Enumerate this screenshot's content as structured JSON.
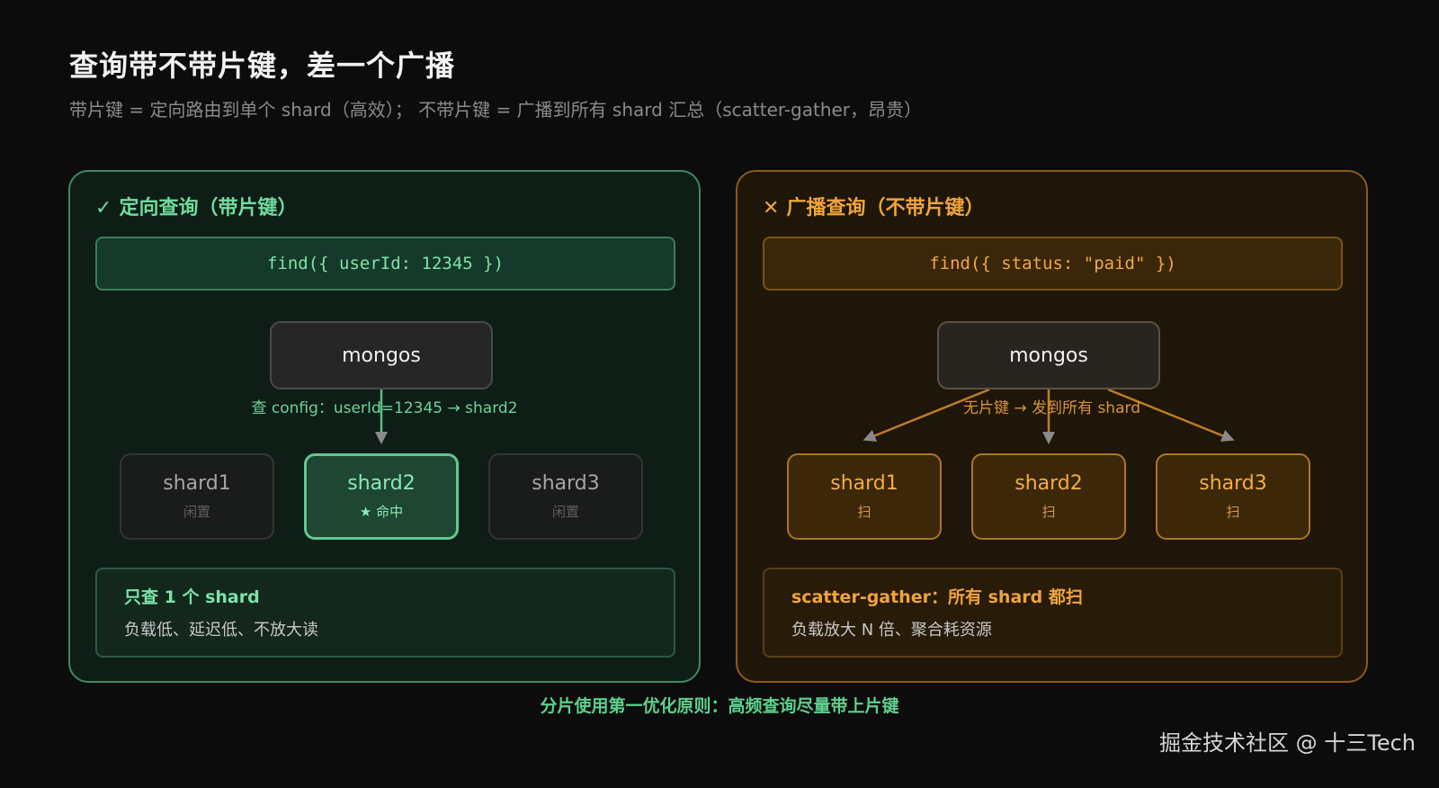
{
  "header": {
    "title": "查询带不带片键，差一个广播",
    "subtitle": "带片键 = 定向路由到单个 shard（高效）； 不带片键 = 广播到所有 shard 汇总（scatter-gather，昂贵）"
  },
  "targeted": {
    "mark": "✓",
    "heading": "定向查询（带片键）",
    "query": "find({ userId: 12345 })",
    "router": "mongos",
    "edge_label": "查 config：userId=12345 → shard2",
    "shards": [
      {
        "name": "shard1",
        "status": "闲置"
      },
      {
        "name": "shard2",
        "status": "★ 命中"
      },
      {
        "name": "shard3",
        "status": "闲置"
      }
    ],
    "summary_title": "只查 1 个 shard",
    "summary_desc": "负载低、延迟低、不放大读",
    "accent_color": "#6fdc9d"
  },
  "broadcast": {
    "mark": "✕",
    "heading": "广播查询（不带片键）",
    "query": "find({ status: \"paid\" })",
    "router": "mongos",
    "edge_label": "无片键 → 发到所有 shard",
    "shards": [
      {
        "name": "shard1",
        "status": "扫"
      },
      {
        "name": "shard2",
        "status": "扫"
      },
      {
        "name": "shard3",
        "status": "扫"
      }
    ],
    "summary_title": "scatter-gather：所有 shard 都扫",
    "summary_desc": "负载放大 N 倍、聚合耗资源",
    "accent_color": "#f0a43a"
  },
  "footer": {
    "principle": "分片使用第一优化原则：高频查询尽量带上片键"
  },
  "watermark": "掘金技术社区 @ 十三Tech"
}
